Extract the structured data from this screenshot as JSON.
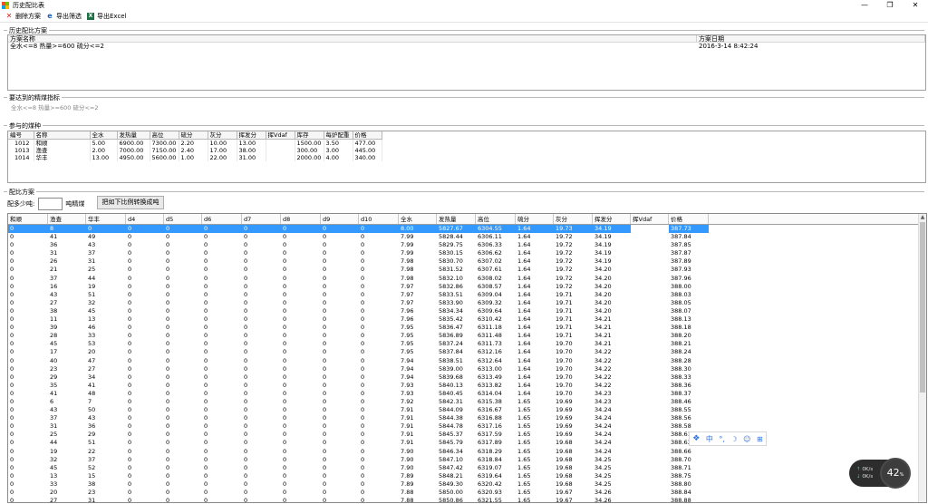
{
  "window": {
    "title": "历史配比表",
    "controls": [
      "—",
      "❐",
      "✕"
    ],
    "icon_colors": [
      "#f25022",
      "#7fba00",
      "#00a4ef",
      "#ffb900"
    ]
  },
  "toolbar": {
    "delete_label": "删除方案",
    "export_filter_label": "导出筛选",
    "export_excel_label": "导出Excel"
  },
  "history": {
    "group_title": "历史配比方案",
    "columns": [
      "方案名称",
      "方案日期"
    ],
    "rows": [
      {
        "name": "全水<=8 热量>=600 硫分<=2",
        "date": "2016-3-14 8:42:24"
      }
    ]
  },
  "target": {
    "group_title": "要达到的精煤指标",
    "text": "全水<=8 热量>=600 硫分<=2"
  },
  "coals": {
    "group_title": "参与的煤种",
    "columns": [
      "编号",
      "名称",
      "全水",
      "发热量",
      "高位",
      "硫分",
      "灰分",
      "挥发分",
      "挥Vdaf",
      "库存",
      "每炉配重",
      "价格"
    ],
    "rows": [
      [
        "1012",
        "和顺",
        "5.00",
        "6900.00",
        "7300.00",
        "2.20",
        "10.00",
        "13.00",
        "",
        "1500.00",
        "3.50",
        "477.00"
      ],
      [
        "1013",
        "渔查",
        "2.00",
        "7000.00",
        "7150.00",
        "2.40",
        "17.00",
        "38.00",
        "",
        "300.00",
        "3.00",
        "445.00"
      ],
      [
        "1014",
        "华丰",
        "13.00",
        "4950.00",
        "5600.00",
        "1.00",
        "22.00",
        "31.00",
        "",
        "2000.00",
        "4.00",
        "340.00"
      ]
    ]
  },
  "mix": {
    "group_title": "配比方案",
    "label": "配多少吨:",
    "unit": "吨精煤",
    "input_value": "",
    "convert_button": "把如下比例转换成吨"
  },
  "grid": {
    "columns": [
      "和顺",
      "渔查",
      "华丰",
      "d4",
      "d5",
      "d6",
      "d7",
      "d8",
      "d9",
      "d10",
      "全水",
      "发热量",
      "高位",
      "硫分",
      "灰分",
      "挥发分",
      "挥Vdaf",
      "价格"
    ],
    "selected_row": 0,
    "rows": [
      [
        "0",
        "8",
        "0",
        "0",
        "0",
        "0",
        "0",
        "0",
        "0",
        "0",
        "8.00",
        "5827.67",
        "6304.55",
        "1.64",
        "19.73",
        "34.19",
        "",
        "387.73"
      ],
      [
        "0",
        "41",
        "49",
        "0",
        "0",
        "0",
        "0",
        "0",
        "0",
        "0",
        "7.99",
        "5828.44",
        "6306.11",
        "1.64",
        "19.72",
        "34.19",
        "",
        "387.84"
      ],
      [
        "0",
        "36",
        "43",
        "0",
        "0",
        "0",
        "0",
        "0",
        "0",
        "0",
        "7.99",
        "5829.75",
        "6306.33",
        "1.64",
        "19.72",
        "34.19",
        "",
        "387.85"
      ],
      [
        "0",
        "31",
        "37",
        "0",
        "0",
        "0",
        "0",
        "0",
        "0",
        "0",
        "7.99",
        "5830.15",
        "6306.62",
        "1.64",
        "19.72",
        "34.19",
        "",
        "387.87"
      ],
      [
        "0",
        "26",
        "31",
        "0",
        "0",
        "0",
        "0",
        "0",
        "0",
        "0",
        "7.98",
        "5830.70",
        "6307.02",
        "1.64",
        "19.72",
        "34.19",
        "",
        "387.89"
      ],
      [
        "0",
        "21",
        "25",
        "0",
        "0",
        "0",
        "0",
        "0",
        "0",
        "0",
        "7.98",
        "5831.52",
        "6307.61",
        "1.64",
        "19.72",
        "34.20",
        "",
        "387.93"
      ],
      [
        "0",
        "37",
        "44",
        "0",
        "0",
        "0",
        "0",
        "0",
        "0",
        "0",
        "7.98",
        "5832.10",
        "6308.02",
        "1.64",
        "19.72",
        "34.20",
        "",
        "387.96"
      ],
      [
        "0",
        "16",
        "19",
        "0",
        "0",
        "0",
        "0",
        "0",
        "0",
        "0",
        "7.97",
        "5832.86",
        "6308.57",
        "1.64",
        "19.72",
        "34.20",
        "",
        "388.00"
      ],
      [
        "0",
        "43",
        "51",
        "0",
        "0",
        "0",
        "0",
        "0",
        "0",
        "0",
        "7.97",
        "5833.51",
        "6309.04",
        "1.64",
        "19.71",
        "34.20",
        "",
        "388.03"
      ],
      [
        "0",
        "27",
        "32",
        "0",
        "0",
        "0",
        "0",
        "0",
        "0",
        "0",
        "7.97",
        "5833.90",
        "6309.32",
        "1.64",
        "19.71",
        "34.20",
        "",
        "388.05"
      ],
      [
        "0",
        "38",
        "45",
        "0",
        "0",
        "0",
        "0",
        "0",
        "0",
        "0",
        "7.96",
        "5834.34",
        "6309.64",
        "1.64",
        "19.71",
        "34.20",
        "",
        "388.07"
      ],
      [
        "0",
        "11",
        "13",
        "0",
        "0",
        "0",
        "0",
        "0",
        "0",
        "0",
        "7.96",
        "5835.42",
        "6310.42",
        "1.64",
        "19.71",
        "34.21",
        "",
        "388.13"
      ],
      [
        "0",
        "39",
        "46",
        "0",
        "0",
        "0",
        "0",
        "0",
        "0",
        "0",
        "7.95",
        "5836.47",
        "6311.18",
        "1.64",
        "19.71",
        "34.21",
        "",
        "388.18"
      ],
      [
        "0",
        "28",
        "33",
        "0",
        "0",
        "0",
        "0",
        "0",
        "0",
        "0",
        "7.95",
        "5836.89",
        "6311.48",
        "1.64",
        "19.71",
        "34.21",
        "",
        "388.20"
      ],
      [
        "0",
        "45",
        "53",
        "0",
        "0",
        "0",
        "0",
        "0",
        "0",
        "0",
        "7.95",
        "5837.24",
        "6311.73",
        "1.64",
        "19.70",
        "34.21",
        "",
        "388.21"
      ],
      [
        "0",
        "17",
        "20",
        "0",
        "0",
        "0",
        "0",
        "0",
        "0",
        "0",
        "7.95",
        "5837.84",
        "6312.16",
        "1.64",
        "19.70",
        "34.22",
        "",
        "388.24"
      ],
      [
        "0",
        "40",
        "47",
        "0",
        "0",
        "0",
        "0",
        "0",
        "0",
        "0",
        "7.94",
        "5838.51",
        "6312.64",
        "1.64",
        "19.70",
        "34.22",
        "",
        "388.28"
      ],
      [
        "0",
        "23",
        "27",
        "0",
        "0",
        "0",
        "0",
        "0",
        "0",
        "0",
        "7.94",
        "5839.00",
        "6313.00",
        "1.64",
        "19.70",
        "34.22",
        "",
        "388.30"
      ],
      [
        "0",
        "29",
        "34",
        "0",
        "0",
        "0",
        "0",
        "0",
        "0",
        "0",
        "7.94",
        "5839.68",
        "6313.49",
        "1.64",
        "19.70",
        "34.22",
        "",
        "388.33"
      ],
      [
        "0",
        "35",
        "41",
        "0",
        "0",
        "0",
        "0",
        "0",
        "0",
        "0",
        "7.93",
        "5840.13",
        "6313.82",
        "1.64",
        "19.70",
        "34.22",
        "",
        "388.36"
      ],
      [
        "0",
        "41",
        "48",
        "0",
        "0",
        "0",
        "0",
        "0",
        "0",
        "0",
        "7.93",
        "5840.45",
        "6314.04",
        "1.64",
        "19.70",
        "34.23",
        "",
        "388.37"
      ],
      [
        "0",
        "6",
        "7",
        "0",
        "0",
        "0",
        "0",
        "0",
        "0",
        "0",
        "7.92",
        "5842.31",
        "6315.38",
        "1.65",
        "19.69",
        "34.23",
        "",
        "388.46"
      ],
      [
        "0",
        "43",
        "50",
        "0",
        "0",
        "0",
        "0",
        "0",
        "0",
        "0",
        "7.91",
        "5844.09",
        "6316.67",
        "1.65",
        "19.69",
        "34.24",
        "",
        "388.55"
      ],
      [
        "0",
        "37",
        "43",
        "0",
        "0",
        "0",
        "0",
        "0",
        "0",
        "0",
        "7.91",
        "5844.38",
        "6316.88",
        "1.65",
        "19.69",
        "34.24",
        "",
        "388.56"
      ],
      [
        "0",
        "31",
        "36",
        "0",
        "0",
        "0",
        "0",
        "0",
        "0",
        "0",
        "7.91",
        "5844.78",
        "6317.16",
        "1.65",
        "19.69",
        "34.24",
        "",
        "388.58"
      ],
      [
        "0",
        "25",
        "29",
        "0",
        "0",
        "0",
        "0",
        "0",
        "0",
        "0",
        "7.91",
        "5845.37",
        "6317.59",
        "1.65",
        "19.69",
        "34.24",
        "",
        "388.61"
      ],
      [
        "0",
        "44",
        "51",
        "0",
        "0",
        "0",
        "0",
        "0",
        "0",
        "0",
        "7.91",
        "5845.79",
        "6317.89",
        "1.65",
        "19.68",
        "34.24",
        "",
        "388.63"
      ],
      [
        "0",
        "19",
        "22",
        "0",
        "0",
        "0",
        "0",
        "0",
        "0",
        "0",
        "7.90",
        "5846.34",
        "6318.29",
        "1.65",
        "19.68",
        "34.24",
        "",
        "388.66"
      ],
      [
        "0",
        "32",
        "37",
        "0",
        "0",
        "0",
        "0",
        "0",
        "0",
        "0",
        "7.90",
        "5847.10",
        "6318.84",
        "1.65",
        "19.68",
        "34.25",
        "",
        "388.70"
      ],
      [
        "0",
        "45",
        "52",
        "0",
        "0",
        "0",
        "0",
        "0",
        "0",
        "0",
        "7.90",
        "5847.42",
        "6319.07",
        "1.65",
        "19.68",
        "34.25",
        "",
        "388.71"
      ],
      [
        "0",
        "13",
        "15",
        "0",
        "0",
        "0",
        "0",
        "0",
        "0",
        "0",
        "7.89",
        "5848.21",
        "6319.64",
        "1.65",
        "19.68",
        "34.25",
        "",
        "388.75"
      ],
      [
        "0",
        "33",
        "38",
        "0",
        "0",
        "0",
        "0",
        "0",
        "0",
        "0",
        "7.89",
        "5849.30",
        "6320.42",
        "1.65",
        "19.68",
        "34.25",
        "",
        "388.80"
      ],
      [
        "0",
        "20",
        "23",
        "0",
        "0",
        "0",
        "0",
        "0",
        "0",
        "0",
        "7.88",
        "5850.00",
        "6320.93",
        "1.65",
        "19.67",
        "34.26",
        "",
        "388.84"
      ],
      [
        "0",
        "27",
        "31",
        "0",
        "0",
        "0",
        "0",
        "0",
        "0",
        "0",
        "7.88",
        "5850.86",
        "6321.55",
        "1.65",
        "19.67",
        "34.26",
        "",
        "388.88"
      ]
    ]
  },
  "ime": {
    "items": [
      "中",
      "°,",
      "☽",
      "☺",
      "⊞"
    ]
  },
  "net_widget": {
    "up": "0K/s",
    "down": "0K/s",
    "percent": "42",
    "percent_unit": "%"
  }
}
